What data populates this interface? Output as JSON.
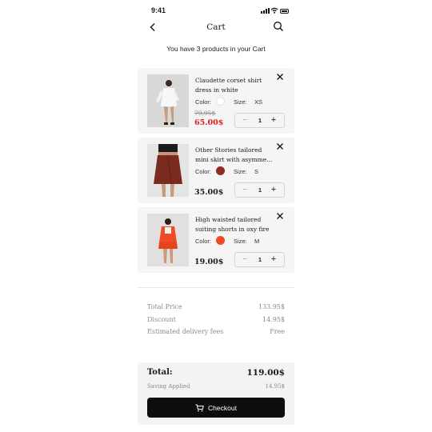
{
  "status": {
    "time": "9:41"
  },
  "header": {
    "title": "Cart",
    "back_icon": "chevron-left-icon",
    "search_icon": "search-icon"
  },
  "cart_summary": "You have 3 products in your Cart",
  "items": [
    {
      "name": "Claudette corset shirt dress in white",
      "color_label": "Color:",
      "color": "#ffffff",
      "size_label": "Size:",
      "size": "XS",
      "old_price": "79.95$",
      "price": "65.00$",
      "on_sale": true,
      "quantity": "1"
    },
    {
      "name": "Other Stories tailored mini skirt with asymme...",
      "color_label": "Color:",
      "color": "#8c2e22",
      "size_label": "Size:",
      "size": "S",
      "price": "35.00$",
      "on_sale": false,
      "quantity": "1"
    },
    {
      "name": "High waisted tailored suiting shorts in oxy fire",
      "color_label": "Color:",
      "color": "#ee4a24",
      "size_label": "Size:",
      "size": "M",
      "price": "19.00$",
      "on_sale": false,
      "quantity": "1"
    }
  ],
  "summary": {
    "total_price_label": "Total Price",
    "total_price": "133.95$",
    "discount_label": "Discount",
    "discount": "14.95$",
    "delivery_label": "Estimated delivery fees",
    "delivery": "Free"
  },
  "total": {
    "label": "Total:",
    "value": "119.00$",
    "saving_label": "Saving Applied",
    "saving_value": "14.95$"
  },
  "checkout": {
    "label": "Checkout",
    "icon": "cart-icon"
  },
  "colors": {
    "sale_red": "#d62020",
    "button_black": "#0e0e0e",
    "card_bg": "#f5f5f6"
  }
}
